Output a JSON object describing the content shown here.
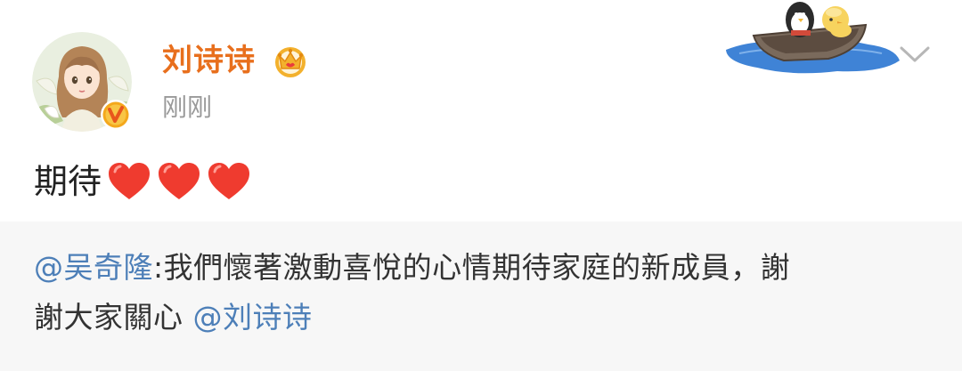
{
  "post": {
    "username": "刘诗诗",
    "timestamp": "刚刚",
    "text": "期待",
    "hearts": [
      "heart-icon",
      "heart-icon",
      "heart-icon"
    ]
  },
  "retweet": {
    "author_mention": "@吴奇隆",
    "content_line1": ":我們懷著激動喜悅的心情期待家庭的新成員，謝",
    "content_line2": "謝大家關心 ",
    "tail_mention": "@刘诗诗"
  },
  "colors": {
    "username": "#e86f1d",
    "mention": "#4d7fb8",
    "timestamp": "#999999",
    "retweet_bg": "#f7f7f7"
  },
  "icons": {
    "avatar": "avatar",
    "verified": "verified-badge-icon",
    "crown": "crown-icon",
    "more": "chevron-down-icon",
    "decoration": "boat-decoration"
  }
}
